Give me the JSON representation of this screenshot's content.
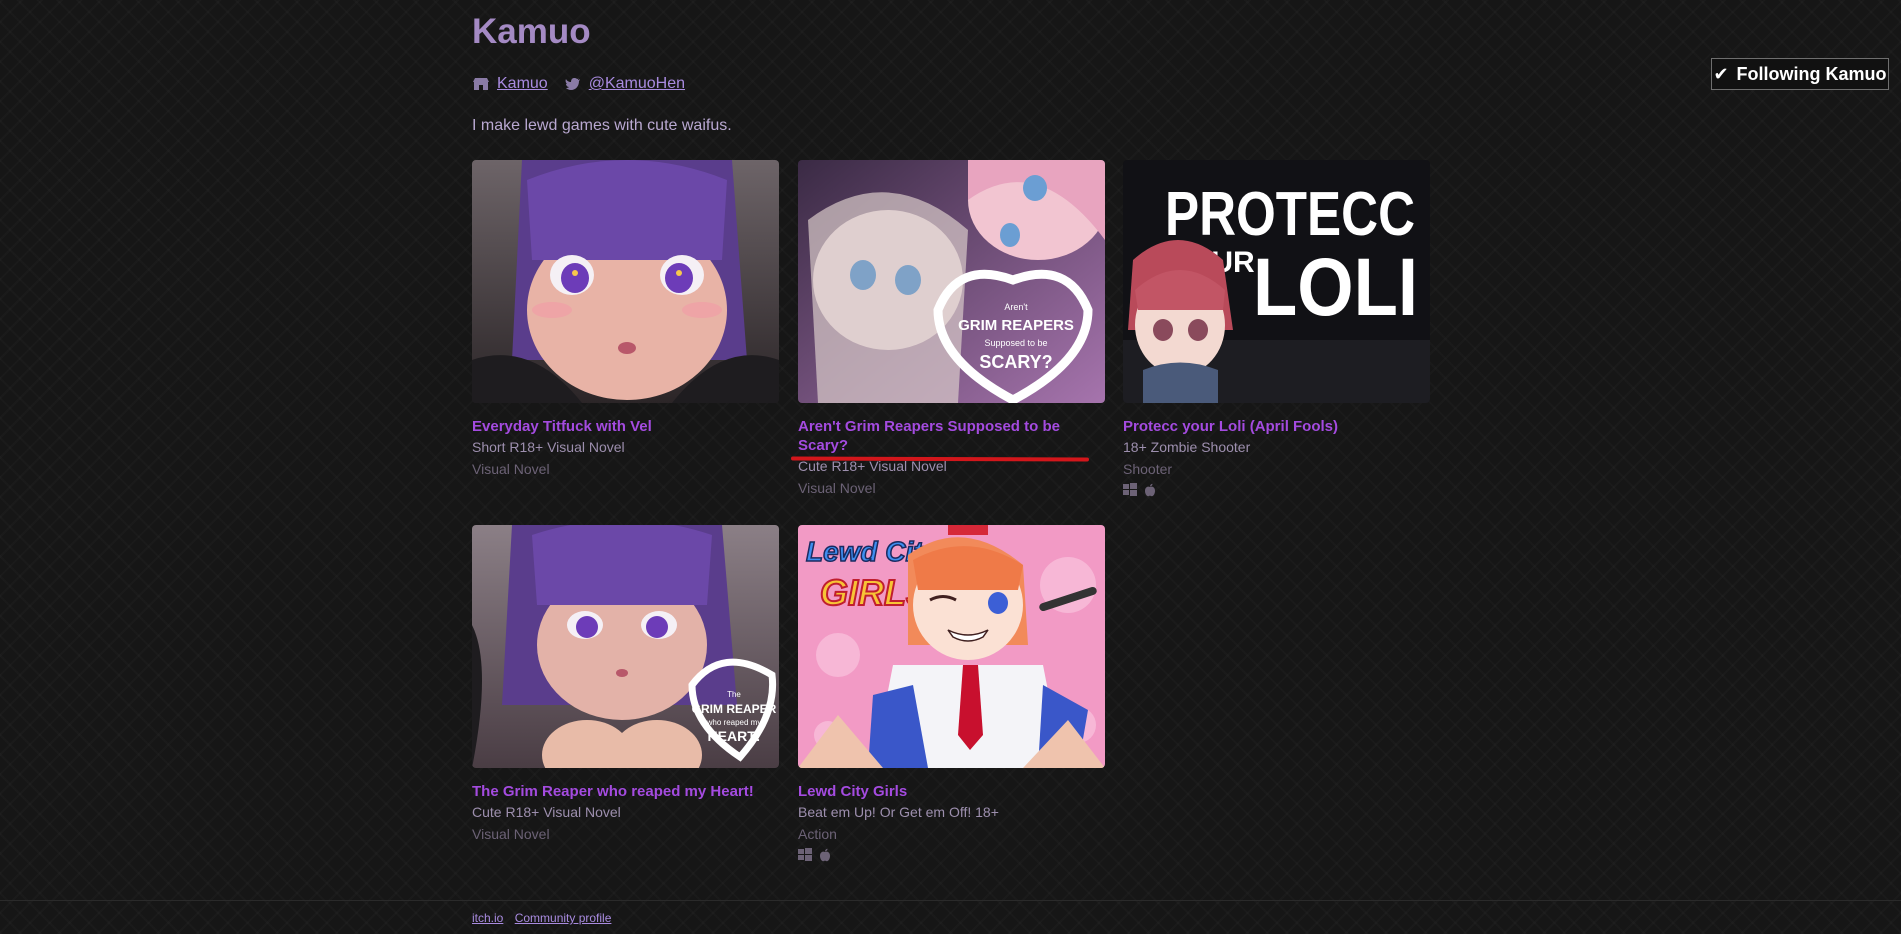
{
  "profile": {
    "name": "Kamuo",
    "itch_link": "Kamuo",
    "twitter_link": "@KamuoHen",
    "bio": "I make lewd games with cute waifus.",
    "follow_label": "Following Kamuo"
  },
  "games": [
    {
      "title": "Everyday Titfuck with Vel",
      "description": "Short R18+ Visual Novel",
      "genre": "Visual Novel",
      "platforms": []
    },
    {
      "title": "Aren't Grim Reapers Supposed to be Scary?",
      "description": "Cute R18+ Visual Novel",
      "genre": "Visual Novel",
      "platforms": [],
      "cover_text": [
        "Aren't",
        "GRIM REAPERS",
        "Supposed to be",
        "SCARY?"
      ]
    },
    {
      "title": "Protecc your Loli (April Fools)",
      "description": "18+ Zombie Shooter",
      "genre": "Shooter",
      "platforms": [
        "windows",
        "apple"
      ],
      "cover_text": [
        "PROTECC",
        "YOUR",
        "LOLI"
      ]
    },
    {
      "title": "The Grim Reaper who reaped my Heart!",
      "description": "Cute R18+ Visual Novel",
      "genre": "Visual Novel",
      "platforms": [],
      "cover_text": [
        "The",
        "GRIM REAPER",
        "who reaped my",
        "HEART!"
      ]
    },
    {
      "title": "Lewd City Girls",
      "description": "Beat em Up! Or Get em Off! 18+",
      "genre": "Action",
      "platforms": [
        "windows",
        "apple"
      ],
      "cover_text": [
        "Lewd City",
        "GIRLS"
      ]
    }
  ],
  "footer": {
    "itchio": "itch.io",
    "community": "Community profile"
  },
  "colors": {
    "background": "#161616",
    "title": "#a48ac4",
    "link": "#a98be0",
    "game_title": "#a44be0",
    "annotation": "#d3161b"
  }
}
